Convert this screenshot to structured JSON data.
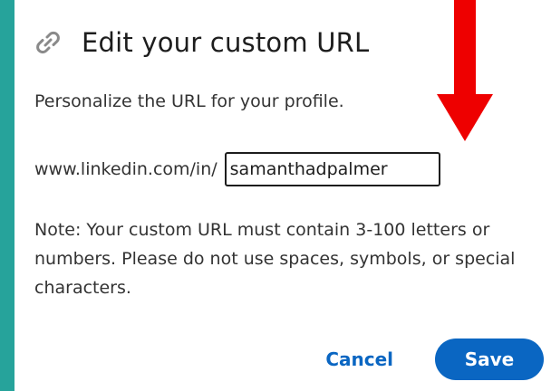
{
  "dialog": {
    "title": "Edit your custom URL",
    "subtitle": "Personalize the URL for your profile.",
    "url_prefix": "www.linkedin.com/in/",
    "url_value": "samanthadpalmer",
    "note": "Note: Your custom URL must contain 3-100 letters or numbers. Please do not use spaces, symbols, or special characters.",
    "cancel_label": "Cancel",
    "save_label": "Save"
  },
  "icons": {
    "header_icon": "link-icon",
    "annotation": "red-arrow-annotation"
  },
  "colors": {
    "background": "#26a39b",
    "accent": "#0a66c2",
    "annotation_arrow": "#ee0000"
  }
}
